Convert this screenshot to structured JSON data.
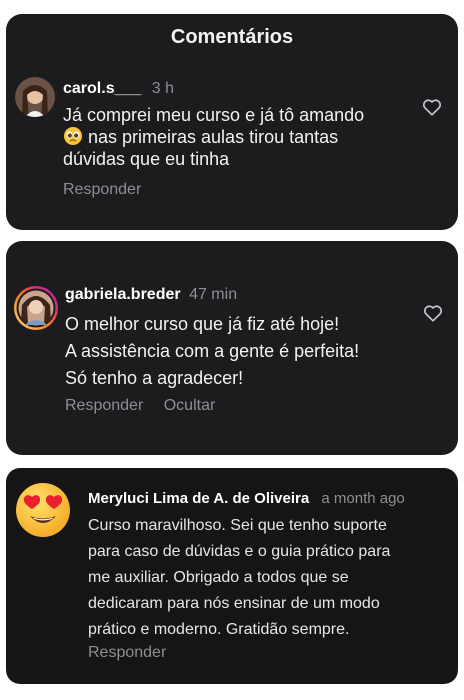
{
  "header": {
    "title": "Comentários"
  },
  "comments": [
    {
      "username": "carol.s___",
      "time": "3 h",
      "lines": [
        "Já comprei meu curso e já tô amando",
        " nas primeiras aulas tirou tantas",
        "dúvidas que eu tinha"
      ],
      "reply_label": "Responder"
    },
    {
      "username": "gabriela.breder",
      "time": "47 min",
      "lines": [
        "O melhor curso que já fiz até hoje!",
        "A assistência com a gente é perfeita!",
        "Só tenho a agradecer!"
      ],
      "reply_label": "Responder",
      "hide_label": "Ocultar"
    },
    {
      "username": "Meryluci Lima de A. de Oliveira",
      "time": "a month ago",
      "lines": [
        "Curso maravilhoso. Sei que tenho suporte",
        "para caso de dúvidas e o guia prático para",
        "me auxiliar. Obrigado a todos que se",
        "dedicaram para nós ensinar de um modo",
        "prático e moderno. Gratidão sempre."
      ],
      "reply_label": "Responder"
    }
  ],
  "icons": {
    "heart": "heart-outline-icon",
    "emoji_pleading": "pleading-face-emoji",
    "emoji_heart_eyes": "heart-eyes-emoji"
  },
  "colors": {
    "card_bg": "#1c1c1e",
    "secondary_text": "#8e8e93",
    "story_ring": "#e1306c"
  }
}
